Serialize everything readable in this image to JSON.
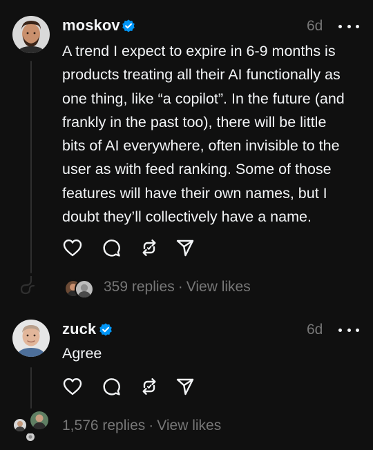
{
  "posts": [
    {
      "username": "moskov",
      "verified": true,
      "time": "6d",
      "text": "A trend I expect to expire in 6-9 months is\nproducts treating all their AI functionally as\none thing, like “a copilot”. In the future (and\nfrankly in the past too), there will be little\nbits of AI everywhere, often invisible to the\nuser as with feed ranking. Some of those\nfeatures will have their own names, but I\ndoubt they’ll collectively have a name.",
      "replies": "359 replies",
      "separator": "·",
      "view_likes": "View likes"
    },
    {
      "username": "zuck",
      "verified": true,
      "time": "6d",
      "text": "Agree",
      "replies": "1,576 replies",
      "separator": "·",
      "view_likes": "View likes"
    }
  ],
  "icons": {
    "like": "heart-icon",
    "reply": "comment-icon",
    "repost": "repost-icon",
    "share": "send-icon",
    "more": "more-icon",
    "verified": "verified-badge-icon"
  },
  "colors": {
    "background": "#101010",
    "text": "#f3f5f7",
    "secondary": "#777777",
    "verified": "#0095f6",
    "thread_line": "#2f2f2f"
  }
}
